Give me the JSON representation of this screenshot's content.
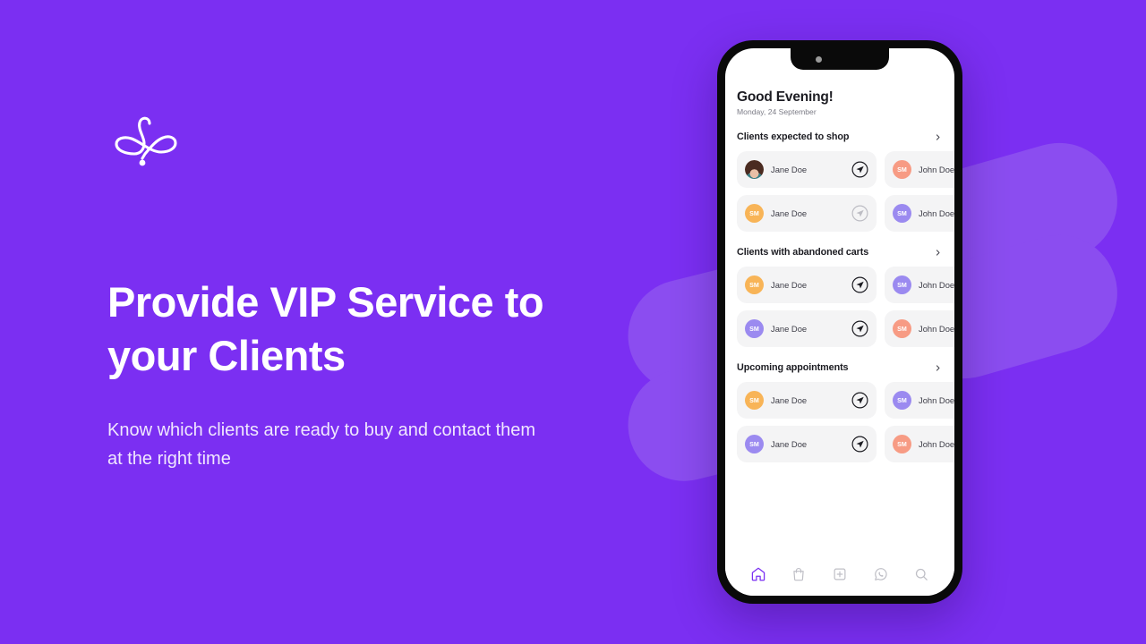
{
  "brand": {
    "logo_name": "flourish-swirl-logo",
    "background_color": "#7B2FF2",
    "accent_color": "#8B4DF0"
  },
  "marketing": {
    "headline": "Provide VIP Service to your Clients",
    "subheadline": "Know which clients are ready to buy and contact them at the right time"
  },
  "phone": {
    "header": {
      "greeting": "Good Evening!",
      "date": "Monday,  24 September"
    },
    "sections": [
      {
        "title": "Clients expected to shop",
        "chevron": "chevron-right-icon",
        "rows": [
          {
            "primary": {
              "name": "Jane Doe",
              "avatar_type": "photo",
              "avatar_initials": "",
              "avatar_color": "#D7C3B4",
              "send_state": "active"
            },
            "secondary": {
              "name": "John Doe",
              "avatar_type": "initials",
              "avatar_initials": "SM",
              "avatar_color": "#F79B84"
            }
          },
          {
            "primary": {
              "name": "Jane Doe",
              "avatar_type": "initials",
              "avatar_initials": "SM",
              "avatar_color": "#F8B457",
              "send_state": "inactive"
            },
            "secondary": {
              "name": "John Doe",
              "avatar_type": "initials",
              "avatar_initials": "SM",
              "avatar_color": "#9B8AF0"
            }
          }
        ]
      },
      {
        "title": "Clients with abandoned carts",
        "chevron": "chevron-right-icon",
        "rows": [
          {
            "primary": {
              "name": "Jane Doe",
              "avatar_type": "initials",
              "avatar_initials": "SM",
              "avatar_color": "#F8B457",
              "send_state": "active"
            },
            "secondary": {
              "name": "John Doe",
              "avatar_type": "initials",
              "avatar_initials": "SM",
              "avatar_color": "#9B8AF0"
            }
          },
          {
            "primary": {
              "name": "Jane Doe",
              "avatar_type": "initials",
              "avatar_initials": "SM",
              "avatar_color": "#9B8AF0",
              "send_state": "active"
            },
            "secondary": {
              "name": "John Doe",
              "avatar_type": "initials",
              "avatar_initials": "SM",
              "avatar_color": "#F79B84"
            }
          }
        ]
      },
      {
        "title": "Upcoming appointments",
        "chevron": "chevron-right-icon",
        "rows": [
          {
            "primary": {
              "name": "Jane Doe",
              "avatar_type": "initials",
              "avatar_initials": "SM",
              "avatar_color": "#F8B457",
              "send_state": "active"
            },
            "secondary": {
              "name": "John Doe",
              "avatar_type": "initials",
              "avatar_initials": "SM",
              "avatar_color": "#9B8AF0"
            }
          },
          {
            "primary": {
              "name": "Jane Doe",
              "avatar_type": "initials",
              "avatar_initials": "SM",
              "avatar_color": "#9B8AF0",
              "send_state": "active"
            },
            "secondary": {
              "name": "John Doe",
              "avatar_type": "initials",
              "avatar_initials": "SM",
              "avatar_color": "#F79B84"
            }
          }
        ]
      }
    ],
    "navbar": [
      {
        "icon": "home-icon",
        "label": "Home",
        "active": true
      },
      {
        "icon": "shopping-bag-icon",
        "label": "Shop",
        "active": false
      },
      {
        "icon": "plus-square-icon",
        "label": "Add",
        "active": false
      },
      {
        "icon": "whatsapp-icon",
        "label": "WhatsApp",
        "active": false
      },
      {
        "icon": "search-icon",
        "label": "Search",
        "active": false
      }
    ]
  }
}
